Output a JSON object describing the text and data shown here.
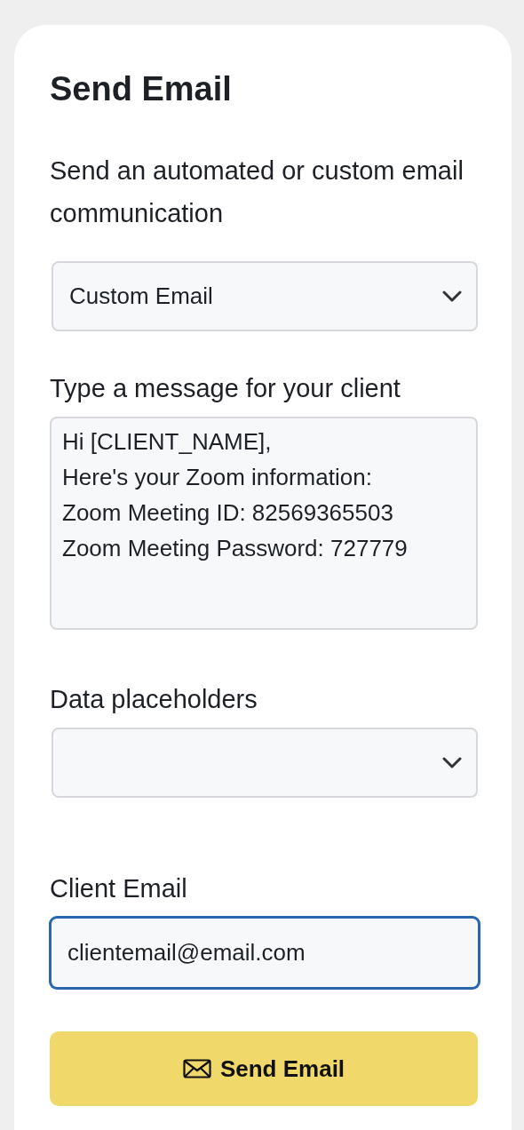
{
  "title": "Send Email",
  "description": "Send an automated or custom email communication",
  "email_type": {
    "value": "Custom Email"
  },
  "message": {
    "label": "Type a message for your client",
    "value": "Hi [CLIENT_NAME],\nHere's your Zoom information:\nZoom Meeting ID: 82569365503\nZoom Meeting Password: 727779"
  },
  "placeholders": {
    "label": "Data placeholders"
  },
  "client_email": {
    "label": "Client Email",
    "value": "clientemail@email.com",
    "focused": true
  },
  "button": {
    "label": "Send Email"
  }
}
